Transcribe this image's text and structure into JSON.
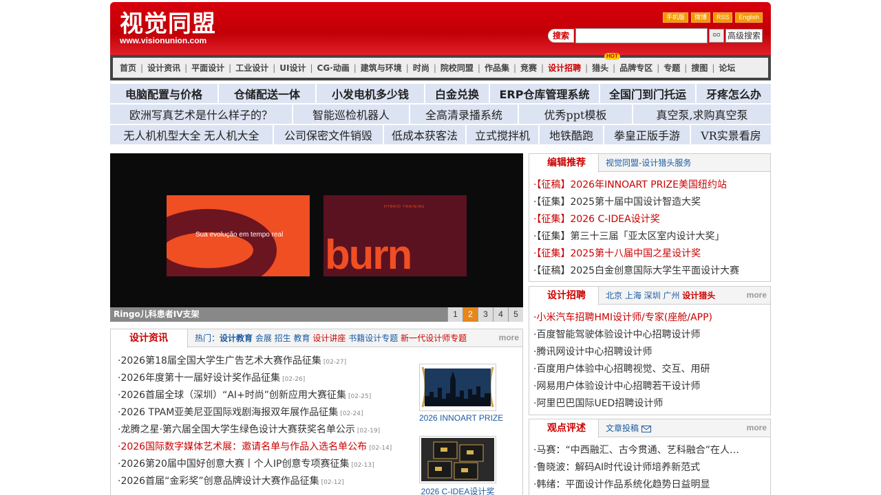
{
  "header": {
    "logo_cn": "视觉同盟",
    "logo_en": "www.visionunion.com",
    "top_links": [
      "手机版",
      "微博",
      "RSS",
      "English"
    ],
    "search_label": "搜索",
    "search_placeholder": "",
    "go_label": "GO",
    "advanced_search": "高级搜索"
  },
  "nav": {
    "items": [
      "首页",
      "设计资讯",
      "平面设计",
      "工业设计",
      "UI设计",
      "CG·动画",
      "建筑与环境",
      "时尚",
      "院校同盟",
      "作品集",
      "竞赛",
      "设计招聘",
      "猎头",
      "品牌专区",
      "专题",
      "搜图",
      "论坛"
    ],
    "hot_badge": "HOT"
  },
  "ads": {
    "row1": [
      "电脑配置与价格",
      "仓储配送一体",
      "小发电机多少钱",
      "白金兑换",
      "ERP仓库管理系统",
      "全国门到门托运",
      "牙疼怎么办"
    ],
    "row2": [
      "欧洲写真艺术是什么样子的？",
      "智能巡检机器人",
      "全高清录播系统",
      "优秀ppt模板",
      "真空泵,求购真空泵"
    ],
    "row3": [
      "无人机机型大全 无人机大全",
      "公司保密文件销毁",
      "低成本获客法",
      "立式搅拌机",
      "地铁酷跑",
      "拳皇正版手游",
      "VR实景看房"
    ]
  },
  "slider": {
    "slide_text": "Sua evolução em tempo real",
    "slide_small": "HYBRID TRAINING",
    "slide_big": "burn",
    "caption": "Ringo儿科患者IV支架",
    "pages": [
      "1",
      "2",
      "3",
      "4",
      "5"
    ],
    "active_page": 2
  },
  "news": {
    "title": "设计资讯",
    "hot_label": "热门：",
    "hot_links": [
      "设计教育",
      "会展",
      "招生",
      "教育",
      "设计讲座",
      "书籍设计专题",
      "新一代设计师专题"
    ],
    "more": "more",
    "items": [
      {
        "text": "·2026第18届全国大学生广告艺术大赛作品征集",
        "date": "[02-27]"
      },
      {
        "text": "·2026年度第十一届好设计奖作品征集",
        "date": "[02-26]"
      },
      {
        "text": "·2026首届全球（深圳）“AI+时尚”创新应用大赛征集",
        "date": "[02-25]"
      },
      {
        "text": "·2026 TPAM亚美尼亚国际戏剧海报双年展作品征集",
        "date": "[02-24]"
      },
      {
        "text": "·龙腾之星·第六届全国大学生绿色设计大赛获奖名单公示",
        "date": "[02-19]"
      },
      {
        "text": "·2026国际数字媒体艺术展：邀请名单与作品入选名单公布",
        "date": "[02-14]"
      },
      {
        "text": "·2026第20届中国好创意大赛丨个人IP创意专项赛征集",
        "date": "[02-13]"
      },
      {
        "text": "·2026首届“金彩奖”创意品牌设计大赛作品征集",
        "date": "[02-12]"
      }
    ],
    "thumbs": [
      "2026 INNOART PRIZE",
      "2026 C-IDEA设计奖"
    ]
  },
  "recommend": {
    "title": "编辑推荐",
    "sub": "视觉同盟-设计猎头服务",
    "items": [
      {
        "text": "·【征稿】2026年INNOART PRIZE美国纽约站",
        "red": true
      },
      {
        "text": "·【征集】2025第十届中国设计智造大奖",
        "red": false
      },
      {
        "text": "·【征集】2026 C-IDEA设计奖",
        "red": true
      },
      {
        "text": "·【征集】第三十三届「亚太区室内设计大奖」",
        "red": false
      },
      {
        "text": "·【征集】2025第十八届中国之星设计奖",
        "red": true
      },
      {
        "text": "·【征稿】2025白金创意国际大学生平面设计大赛",
        "red": false
      }
    ]
  },
  "jobs": {
    "title": "设计招聘",
    "cities": "北京 上海 深圳 广州",
    "hunter": "设计猎头",
    "more": "more",
    "items": [
      {
        "text": "·小米汽车招聘HMI设计师/专家(座舱/APP)",
        "red": true
      },
      {
        "text": "·百度智能驾驶体验设计中心招聘设计师",
        "red": false
      },
      {
        "text": "·腾讯网设计中心招聘设计师",
        "red": false
      },
      {
        "text": "·百度用户体验中心招聘视觉、交互、用研",
        "red": false
      },
      {
        "text": "·网易用户体验设计中心招聘若干设计师",
        "red": false
      },
      {
        "text": "·阿里巴巴国际UED招聘设计师",
        "red": false
      }
    ]
  },
  "views": {
    "title": "观点评述",
    "sub": "文章投稿",
    "more": "more",
    "items": [
      "·马赛：“中西融汇、古今贯通、艺科融合”在人…",
      "·鲁晓波：解码AI时代设计师培养新范式",
      "·韩绪：平面设计作品系统化趋势日益明显"
    ]
  },
  "colors": {
    "brand_red": "#c20007",
    "link_blue": "#1a5aa0",
    "ad_bg": "#dce3f2",
    "accent_orange": "#e8861a"
  }
}
